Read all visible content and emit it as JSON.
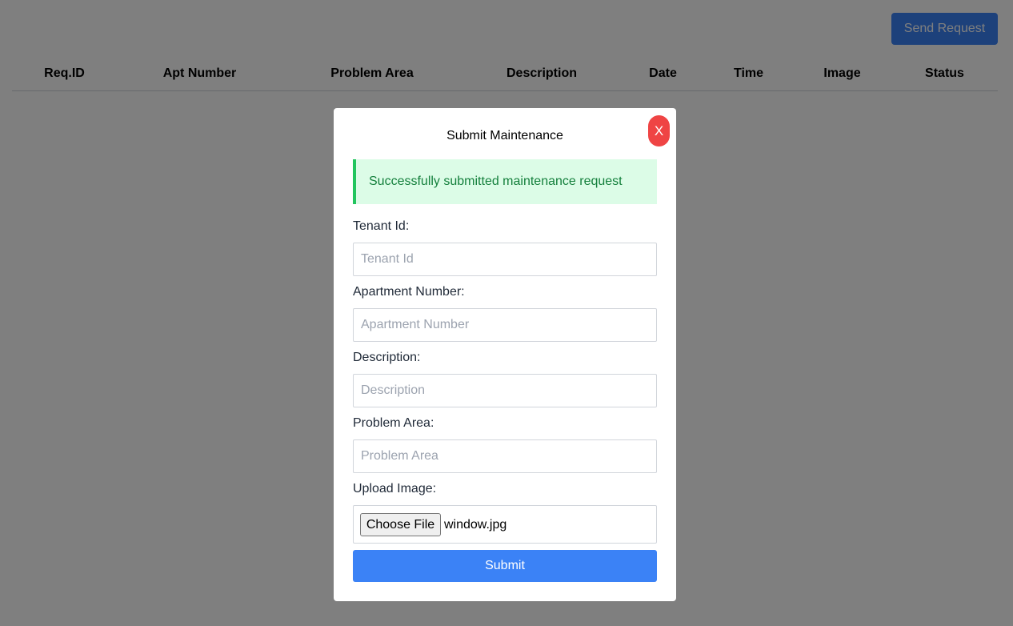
{
  "header": {
    "send_request_label": "Send Request"
  },
  "table": {
    "columns": [
      "Req.ID",
      "Apt Number",
      "Problem Area",
      "Description",
      "Date",
      "Time",
      "Image",
      "Status"
    ]
  },
  "modal": {
    "title": "Submit Maintenance",
    "close_label": "X",
    "alert": "Successfully submitted maintenance request",
    "fields": {
      "tenant_id": {
        "label": "Tenant Id:",
        "placeholder": "Tenant Id",
        "value": ""
      },
      "apartment_number": {
        "label": "Apartment Number:",
        "placeholder": "Apartment Number",
        "value": ""
      },
      "description": {
        "label": "Description:",
        "placeholder": "Description",
        "value": ""
      },
      "problem_area": {
        "label": "Problem Area:",
        "placeholder": "Problem Area",
        "value": ""
      }
    },
    "upload": {
      "label": "Upload Image:",
      "choose_file_label": "Choose File",
      "file_name": "window.jpg"
    },
    "submit_label": "Submit"
  },
  "colors": {
    "primary": "#3b82f6",
    "danger": "#ef4444",
    "success_bg": "#dcfce7",
    "success_border": "#22c55e",
    "success_text": "#15803d"
  }
}
